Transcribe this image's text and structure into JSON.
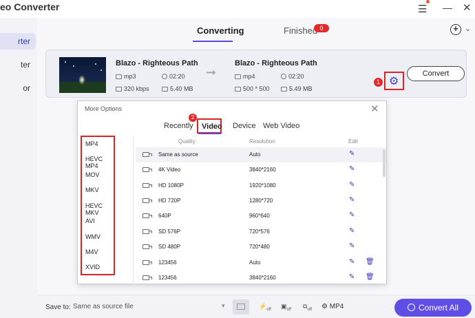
{
  "app": {
    "title": "eo Converter"
  },
  "sidebar": {
    "items": [
      {
        "label": "rter",
        "active": true
      },
      {
        "label": "ter",
        "active": false
      },
      {
        "label": "or",
        "active": false
      }
    ]
  },
  "tabs": {
    "converting": "Converting",
    "finished": "Finished",
    "finished_count": "0"
  },
  "file": {
    "source": {
      "name": "Blazo - Righteous Path",
      "format": "mp3",
      "duration": "02:20",
      "bitrate": "320 kbps",
      "size": "5.40 MB"
    },
    "target": {
      "name": "Blazo - Righteous Path",
      "format": "mp4",
      "duration": "02:20",
      "resolution": "500 * 500",
      "size": "5.49 MB"
    },
    "marker": "1",
    "convert_label": "Convert"
  },
  "dialog": {
    "title": "More Options",
    "marker": "2",
    "tabs": [
      "Recently",
      "Video",
      "Device",
      "Web Video"
    ],
    "active_tab": "Video",
    "formats": [
      "MP4",
      "HEVC MP4",
      "MOV",
      "MKV",
      "HEVC MKV",
      "AVI",
      "WMV",
      "M4V",
      "XVID"
    ],
    "columns": {
      "quality": "Quality",
      "resolution": "Resolution",
      "edit": "Edit"
    },
    "rows": [
      {
        "quality": "Same as source",
        "resolution": "Auto",
        "deletable": false
      },
      {
        "quality": "4K Video",
        "resolution": "3840*2160",
        "deletable": false
      },
      {
        "quality": "HD 1080P",
        "resolution": "1920*1080",
        "deletable": false
      },
      {
        "quality": "HD 720P",
        "resolution": "1280*720",
        "deletable": false
      },
      {
        "quality": "640P",
        "resolution": "960*640",
        "deletable": false
      },
      {
        "quality": "SD 576P",
        "resolution": "720*576",
        "deletable": false
      },
      {
        "quality": "SD 480P",
        "resolution": "720*480",
        "deletable": false
      },
      {
        "quality": "123456",
        "resolution": "Auto",
        "deletable": true
      },
      {
        "quality": "123456",
        "resolution": "3840*2160",
        "deletable": true
      }
    ]
  },
  "bottom": {
    "save_label": "Save to:",
    "save_value": "Same as source file",
    "tools": [
      "off",
      "off",
      "off"
    ],
    "format_label": "MP4",
    "convert_all": "Convert All"
  },
  "colors": {
    "accent": "#5e4ee6",
    "highlight": "#d72525"
  }
}
